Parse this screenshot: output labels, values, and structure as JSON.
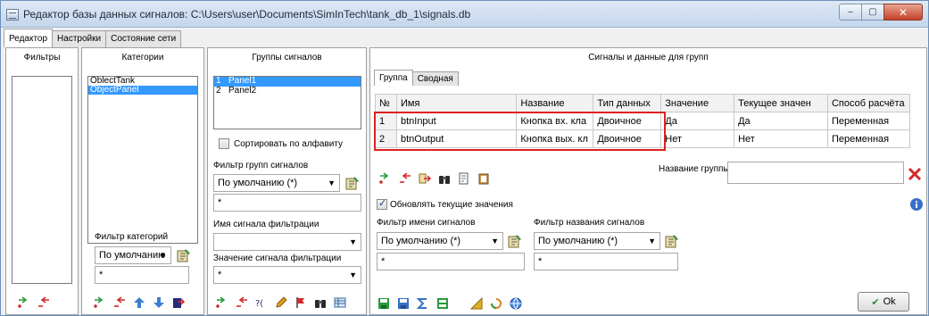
{
  "window": {
    "title": "Редактор базы данных сигналов: C:\\Users\\user\\Documents\\SimInTech\\tank_db_1\\signals.db",
    "min_glyph": "–",
    "max_glyph": "▢",
    "close_glyph": "✕"
  },
  "main_tabs": [
    "Редактор",
    "Настройки",
    "Состояние сети"
  ],
  "filters_panel": {
    "title": "Фильтры"
  },
  "categories_panel": {
    "title": "Категории",
    "items": [
      "OblectTank",
      "ObjectPanel"
    ],
    "selected_index": 1,
    "filter_label": "Фильтр категорий",
    "filter_combo": "По умолчанию",
    "filter_text": "*"
  },
  "groups_panel": {
    "title": "Группы сигналов",
    "items": [
      {
        "num": "1",
        "name": "Panel1"
      },
      {
        "num": "2",
        "name": "Panel2"
      }
    ],
    "selected_index": 0,
    "sort_label": "Сортировать по алфавиту",
    "sort_checked": false,
    "group_filter_label": "Фильтр групп сигналов",
    "group_filter_combo": "По умолчанию (*)",
    "group_filter_text": "*",
    "signal_name_filter_label": "Имя сигнала фильтрации",
    "signal_name_filter_value": "",
    "signal_value_filter_label": "Значение сигнала фильтрации",
    "signal_value_filter_value": "*"
  },
  "signals_panel": {
    "title": "Сигналы и данные для групп",
    "tabs": [
      "Группа",
      "Сводная"
    ],
    "columns": [
      "№",
      "Имя",
      "Название",
      "Тип данных",
      "Значение",
      "Текущее значен",
      "Способ расчёта"
    ],
    "rows": [
      [
        "1",
        "btnInput",
        "Кнопка вх. кла",
        "Двоичное",
        "Да",
        "Да",
        "Переменная"
      ],
      [
        "2",
        "btnOutput",
        "Кнопка вых. кл",
        "Двоичное",
        "Нет",
        "Нет",
        "Переменная"
      ]
    ],
    "group_name_label": "Название группы",
    "group_name_value": "",
    "update_label": "Обновлять текущие значения",
    "update_checked": true,
    "name_filter_label": "Фильтр имени сигналов",
    "name_filter_combo": "По умолчанию (*)",
    "name_filter_text": "*",
    "title_filter_label": "Фильтр названия сигналов",
    "title_filter_combo": "По умолчанию (*)",
    "title_filter_text": "*",
    "ok_label": "Ok"
  },
  "colors": {
    "selection": "#3399ff",
    "highlight_box": "#e02020",
    "title_gradient_top": "#dfe9f5",
    "close_button": "#c4412a"
  }
}
